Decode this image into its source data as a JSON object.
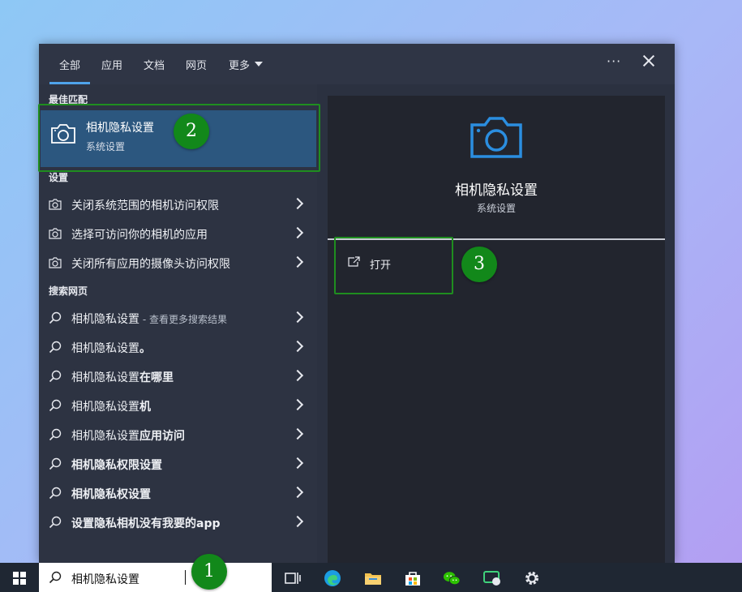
{
  "tabs": [
    "全部",
    "应用",
    "文档",
    "网页",
    "更多"
  ],
  "sections": {
    "best_match": "最佳匹配",
    "settings": "设置",
    "web": "搜索网页"
  },
  "best": {
    "title": "相机隐私设置",
    "subtitle": "系统设置"
  },
  "settings_items": [
    "关闭系统范围的相机访问权限",
    "选择可访问你的相机的应用",
    "关闭所有应用的摄像头访问权限"
  ],
  "web_items": [
    {
      "prefix": "相机隐私设置",
      "bold": "",
      "suffix": " - 查看更多搜索结果"
    },
    {
      "prefix": "相机隐私设置",
      "bold": "。",
      "suffix": ""
    },
    {
      "prefix": "相机隐私设置",
      "bold": "在哪里",
      "suffix": ""
    },
    {
      "prefix": "相机隐私设置",
      "bold": "机",
      "suffix": ""
    },
    {
      "prefix": "相机隐私设置",
      "bold": "应用访问",
      "suffix": ""
    },
    {
      "prefix": "",
      "bold": "相机隐私权限设置",
      "suffix": ""
    },
    {
      "prefix": "",
      "bold": "相机隐私权设置",
      "suffix": ""
    },
    {
      "prefix": "",
      "bold": "设置隐私相机没有我要的app",
      "suffix": ""
    }
  ],
  "preview": {
    "title": "相机隐私设置",
    "subtitle": "系统设置",
    "open_label": "打开"
  },
  "taskbar": {
    "search_value": "相机隐私设置"
  },
  "badges": [
    "1",
    "2",
    "3"
  ],
  "colors": {
    "accent": "#4fa3ea",
    "highlight": "#1f8e1f",
    "best_bg": "#2c577f"
  }
}
